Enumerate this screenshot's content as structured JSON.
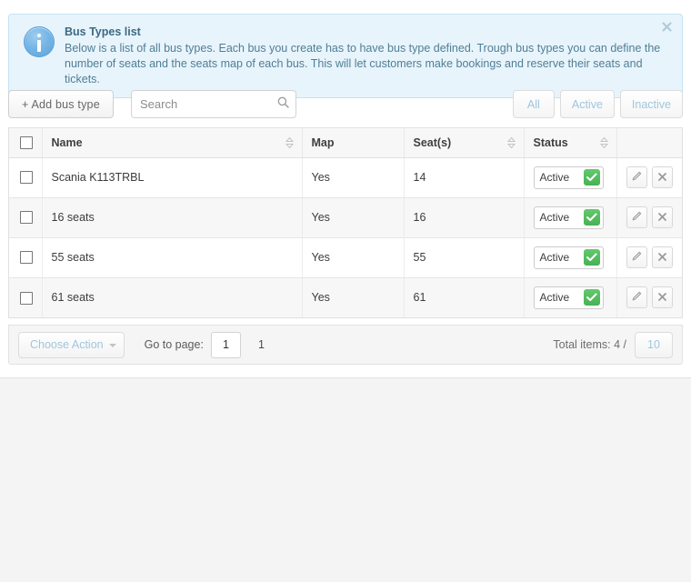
{
  "alert": {
    "title": "Bus Types list",
    "text": "Below is a list of all bus types. Each bus you create has to have bus type defined. Trough bus types you can define the number of seats and the seats map of each bus. This will let customers make bookings and reserve their seats and tickets.",
    "close_label": "✖"
  },
  "toolbar": {
    "add_label": "+ Add bus type",
    "search_placeholder": "Search",
    "search_value": "",
    "filters": [
      {
        "label": "All"
      },
      {
        "label": "Active"
      },
      {
        "label": "Inactive"
      }
    ]
  },
  "table": {
    "columns": [
      {
        "label": "Name",
        "sortable": true
      },
      {
        "label": "Map",
        "sortable": false
      },
      {
        "label": "Seat(s)",
        "sortable": true
      },
      {
        "label": "Status",
        "sortable": true
      }
    ],
    "rows": [
      {
        "name": "Scania K113TRBL",
        "map": "Yes",
        "seats": "14",
        "status": "Active"
      },
      {
        "name": "16 seats",
        "map": "Yes",
        "seats": "16",
        "status": "Active"
      },
      {
        "name": "55 seats",
        "map": "Yes",
        "seats": "55",
        "status": "Active"
      },
      {
        "name": "61 seats",
        "map": "Yes",
        "seats": "61",
        "status": "Active"
      }
    ]
  },
  "footer": {
    "action_label": "Choose Action",
    "goto_label": "Go to page:",
    "page_value": "1",
    "page_count": "1",
    "total_label": "Total items: 4 /",
    "per_page": "10"
  },
  "colors": {
    "alert_bg": "#e8f4fb",
    "alert_border": "#c5e2f2",
    "accent_link": "#9ec6dd",
    "status_green": "#4cb85c",
    "page_bg": "#f4f4f4"
  }
}
